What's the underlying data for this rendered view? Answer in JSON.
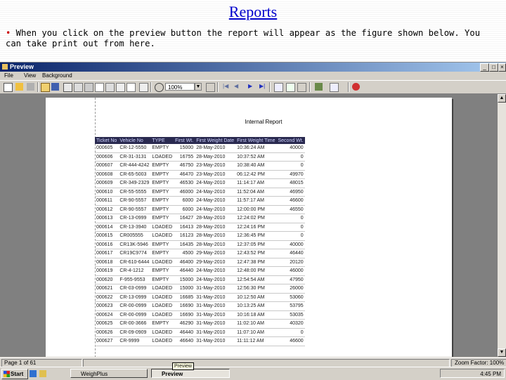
{
  "slide": {
    "title": "Reports",
    "bullet": "•",
    "text": " When you click on the preview button the report will appear as the figure shown below. You can take print out from here."
  },
  "window": {
    "title": "Preview",
    "min": "_",
    "max": "□",
    "close": "×",
    "menu": [
      "File",
      "View",
      "Background"
    ],
    "zoom": "100%"
  },
  "report": {
    "title": "Internal Report",
    "columns": [
      "Ticket No",
      "Vehicle No",
      "TYPE",
      "First Wt.",
      "First Weight Date",
      "First Weight Time",
      "Second Wt."
    ],
    "rows": [
      [
        "000605",
        "CR-12-5550",
        "EMPTY",
        "15000",
        "28-May-2010",
        "10:36:24 AM",
        "40000"
      ],
      [
        "000606",
        "CR-31-3131",
        "LOADED",
        "16755",
        "28-May-2010",
        "10:37:52 AM",
        "0"
      ],
      [
        "000607",
        "CR-444-4242",
        "EMPTY",
        "46750",
        "23-May-2010",
        "10:38:40 AM",
        "0"
      ],
      [
        "000608",
        "CR-65-5003",
        "EMPTY",
        "46470",
        "23-May-2010",
        "06:12:42 PM",
        "49970"
      ],
      [
        "000609",
        "CR-349-2329",
        "EMPTY",
        "46530",
        "24-May-2010",
        "11:14:17 AM",
        "48015"
      ],
      [
        "000610",
        "CR-55-5555",
        "EMPTY",
        "46000",
        "24-May-2010",
        "11:52:04 AM",
        "46950"
      ],
      [
        "000611",
        "CR-90-5557",
        "EMPTY",
        "6000",
        "24-May-2010",
        "11:57:17 AM",
        "46600"
      ],
      [
        "000612",
        "CR-90-5557",
        "EMPTY",
        "6000",
        "24-May-2010",
        "12:00:00 PM",
        "46550"
      ],
      [
        "000613",
        "CR-13-0999",
        "EMPTY",
        "16427",
        "28-May-2010",
        "12:24:02 PM",
        "0"
      ],
      [
        "000614",
        "CR-13-3940",
        "LOADED",
        "16413",
        "28-May-2010",
        "12:24:16 PM",
        "0"
      ],
      [
        "000615",
        "CR005555",
        "LOADED",
        "16123",
        "28-May-2010",
        "12:36:45 PM",
        "0"
      ],
      [
        "000616",
        "CR13K-5946",
        "EMPTY",
        "16435",
        "28-May-2010",
        "12:37:05 PM",
        "40000"
      ],
      [
        "000617",
        "CR19C9774",
        "EMPTY",
        "4500",
        "29-May-2010",
        "12:43:52 PM",
        "46440"
      ],
      [
        "000618",
        "CR-610-6444",
        "LOADED",
        "46400",
        "29-May-2010",
        "12:47:38 PM",
        "20120"
      ],
      [
        "000619",
        "CR-4-1212",
        "EMPTY",
        "46440",
        "24-May-2010",
        "12:48:00 PM",
        "46000"
      ],
      [
        "000620",
        "F-955-9553",
        "EMPTY",
        "15000",
        "24-May-2010",
        "12:54:54 AM",
        "47950"
      ],
      [
        "000621",
        "CR-03-0999",
        "LOADED",
        "15000",
        "31-May-2010",
        "12:56:30 PM",
        "26000"
      ],
      [
        "000622",
        "CR-13-0999",
        "LOADED",
        "16685",
        "31-May-2010",
        "10:12:50 AM",
        "53060"
      ],
      [
        "000623",
        "CR-00-0999",
        "LOADED",
        "16690",
        "31-May-2010",
        "10:13:25 AM",
        "53795"
      ],
      [
        "000624",
        "CR-00-0999",
        "LOADED",
        "16690",
        "31-May-2010",
        "10:16:18 AM",
        "53035"
      ],
      [
        "000625",
        "CR-00-3666",
        "EMPTY",
        "46290",
        "31-May-2010",
        "11:02:10 AM",
        "40320"
      ],
      [
        "000626",
        "CR-09-0909",
        "LOADED",
        "46440",
        "31-May-2010",
        "11:07:10 AM",
        "0"
      ],
      [
        "000627",
        "CR-9999",
        "LOADED",
        "46640",
        "31-May-2010",
        "11:11:12 AM",
        "46600"
      ]
    ]
  },
  "status": {
    "page": "Page 1 of 61",
    "zoom_factor": "Zoom Factor: 100%"
  },
  "taskbar": {
    "start": "Start",
    "tasks": [
      "WeighPlus",
      "Preview"
    ],
    "tooltip": "Preview",
    "clock": "4:45 PM"
  }
}
